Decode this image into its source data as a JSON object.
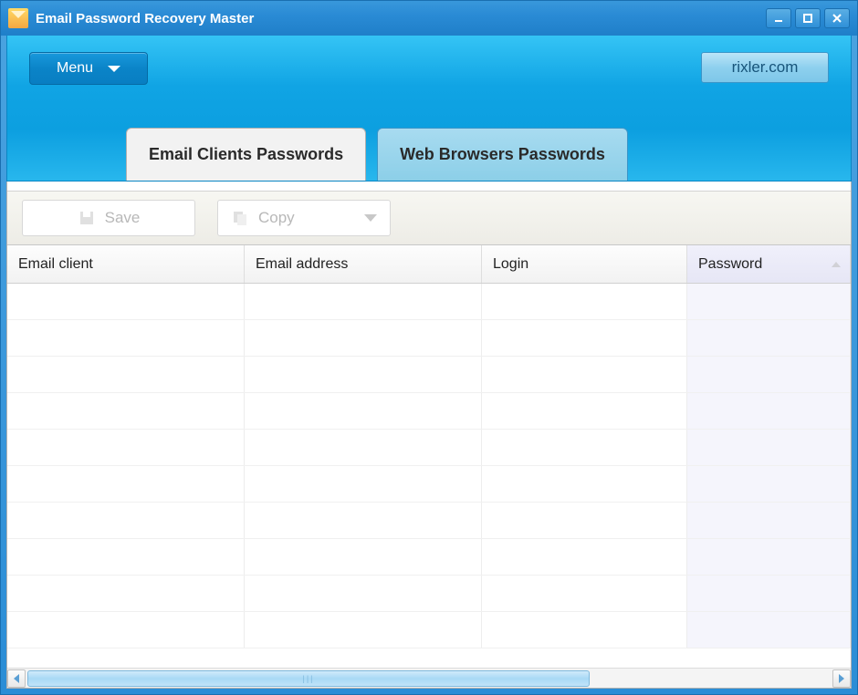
{
  "window": {
    "title": "Email Password Recovery Master"
  },
  "header": {
    "menu_label": "Menu",
    "site_link": "rixler.com"
  },
  "tabs": [
    {
      "label": "Email Clients Passwords",
      "active": true
    },
    {
      "label": "Web Browsers Passwords",
      "active": false
    }
  ],
  "toolbar": {
    "save_label": "Save",
    "copy_label": "Copy"
  },
  "columns": [
    {
      "label": "Email client",
      "sorted": false
    },
    {
      "label": "Email address",
      "sorted": false
    },
    {
      "label": "Login",
      "sorted": false
    },
    {
      "label": "Password",
      "sorted": true
    }
  ],
  "rows": [
    {},
    {},
    {},
    {},
    {},
    {},
    {},
    {},
    {},
    {}
  ]
}
